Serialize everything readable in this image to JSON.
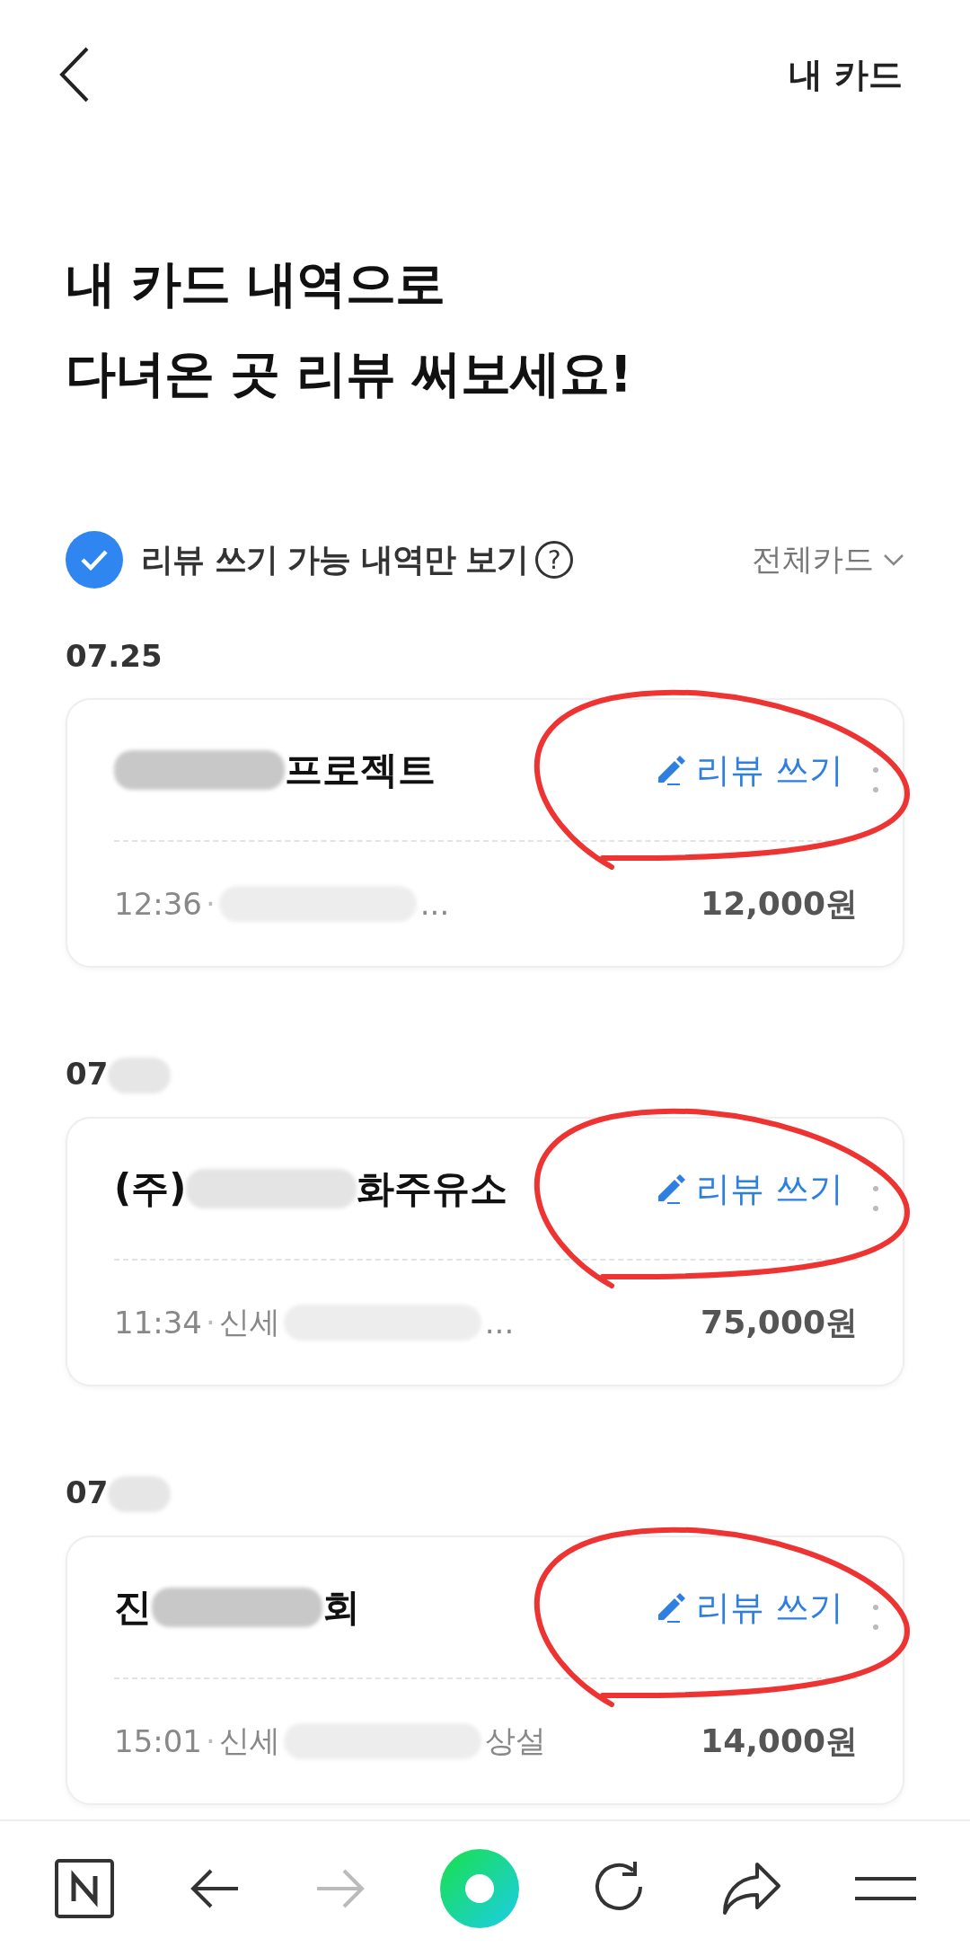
{
  "header": {
    "title": "내 카드"
  },
  "headline": [
    "내 카드 내역으로",
    "다녀온 곳 리뷰 써보세요!"
  ],
  "filter": {
    "checked": true,
    "label": "리뷰 쓰기 가능 내역만 보기",
    "help": "?",
    "card_select": "전체카드"
  },
  "groups": [
    {
      "date": [
        {
          "kind": "text",
          "text": "07.25"
        }
      ],
      "item": {
        "name": [
          {
            "kind": "redacted"
          },
          {
            "kind": "text",
            "text": "프로젝트"
          }
        ],
        "review": "리뷰 쓰기",
        "detail": [
          {
            "kind": "text",
            "text": "12:36"
          },
          {
            "kind": "dot",
            "text": "·"
          },
          {
            "kind": "redacted"
          },
          {
            "kind": "text",
            "text": "..."
          }
        ],
        "amount": "12,000원",
        "circled": true
      }
    },
    {
      "date": [
        {
          "kind": "text",
          "text": "07"
        },
        {
          "kind": "redacted"
        }
      ],
      "item": {
        "name": [
          {
            "kind": "text",
            "text": "(주)"
          },
          {
            "kind": "redacted"
          },
          {
            "kind": "text",
            "text": "화주유소"
          }
        ],
        "review": "리뷰 쓰기",
        "detail": [
          {
            "kind": "text",
            "text": "11:34"
          },
          {
            "kind": "dot",
            "text": "·"
          },
          {
            "kind": "text",
            "text": "신세"
          },
          {
            "kind": "redacted"
          },
          {
            "kind": "text",
            "text": "..."
          }
        ],
        "amount": "75,000원",
        "circled": true
      }
    },
    {
      "date": [
        {
          "kind": "text",
          "text": "07"
        },
        {
          "kind": "redacted"
        }
      ],
      "item": {
        "name": [
          {
            "kind": "text",
            "text": "진"
          },
          {
            "kind": "redacted"
          },
          {
            "kind": "text",
            "text": "회"
          }
        ],
        "review": "리뷰 쓰기",
        "detail": [
          {
            "kind": "text",
            "text": "15:01"
          },
          {
            "kind": "dot",
            "text": "·"
          },
          {
            "kind": "text",
            "text": "신세"
          },
          {
            "kind": "redacted"
          },
          {
            "kind": "text",
            "text": "상설"
          }
        ],
        "amount": "14,000원",
        "circled": true
      }
    }
  ],
  "bottom_bar": [
    {
      "kind": "naver"
    },
    {
      "kind": "back",
      "disabled": false
    },
    {
      "kind": "forward",
      "disabled": true
    },
    {
      "kind": "home"
    },
    {
      "kind": "reload"
    },
    {
      "kind": "share"
    },
    {
      "kind": "menu"
    }
  ]
}
